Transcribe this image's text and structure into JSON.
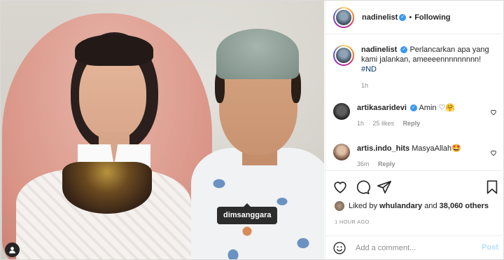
{
  "post": {
    "author": "nadinelist",
    "follow_status": "Following",
    "caption_text": "Perlancarkan apa yang kami jalankan, ameeeennnnnnnnn!",
    "hashtag": "#ND",
    "caption_time": "1h"
  },
  "photo": {
    "tag_label": "dimsanggara"
  },
  "comments": [
    {
      "username": "artikasaridevi",
      "text": "Amin ♡🤗",
      "time": "1h",
      "likes": "25 likes",
      "reply": "Reply",
      "verified": true
    },
    {
      "username": "artis.indo_hits",
      "text": "MasyaAllah🤩",
      "time": "36m",
      "reply": "Reply",
      "verified": false
    }
  ],
  "engagement": {
    "liked_by_prefix": "Liked by",
    "liked_by_user": "whulandary",
    "liked_by_middle": "and",
    "liked_by_count": "38,060 others",
    "posted_ago": "1 HOUR AGO"
  },
  "composer": {
    "placeholder": "Add a comment...",
    "post_label": "Post"
  },
  "colors": {
    "verified_blue": "#3897f0",
    "hashtag": "#00376b",
    "muted": "#8e8e8e",
    "post_disabled": "#b2dffc"
  }
}
